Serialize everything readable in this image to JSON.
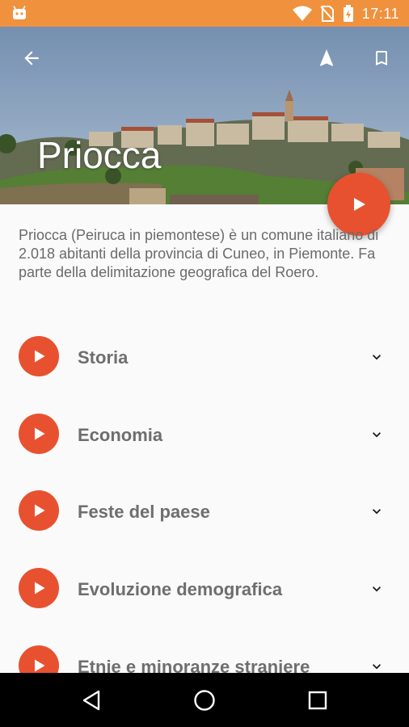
{
  "status_bar": {
    "time": "17:11",
    "icons": [
      "android-icon",
      "wifi-icon",
      "no-sim-icon",
      "battery-charging-icon"
    ]
  },
  "header": {
    "title": "Priocca",
    "actions": [
      "back-arrow-icon",
      "navigation-icon",
      "bookmark-icon"
    ],
    "fab_icon": "play-icon"
  },
  "intro": {
    "text": "Priocca (Peiruca in piemontese) è un comune italiano di 2.018 abitanti della provincia di Cuneo, in Piemonte. Fa parte della delimitazione geografica del Roero."
  },
  "sections": [
    {
      "label": "Storia"
    },
    {
      "label": "Economia"
    },
    {
      "label": "Feste del paese"
    },
    {
      "label": "Evoluzione demografica"
    },
    {
      "label": "Etnie e minoranze straniere"
    }
  ],
  "nav_bar": {
    "buttons": [
      "back-triangle-icon",
      "home-circle-icon",
      "recents-square-icon"
    ]
  },
  "colors": {
    "status_bar": "#f0913d",
    "accent": "#e8512f",
    "text_secondary": "#6b6b6b"
  }
}
